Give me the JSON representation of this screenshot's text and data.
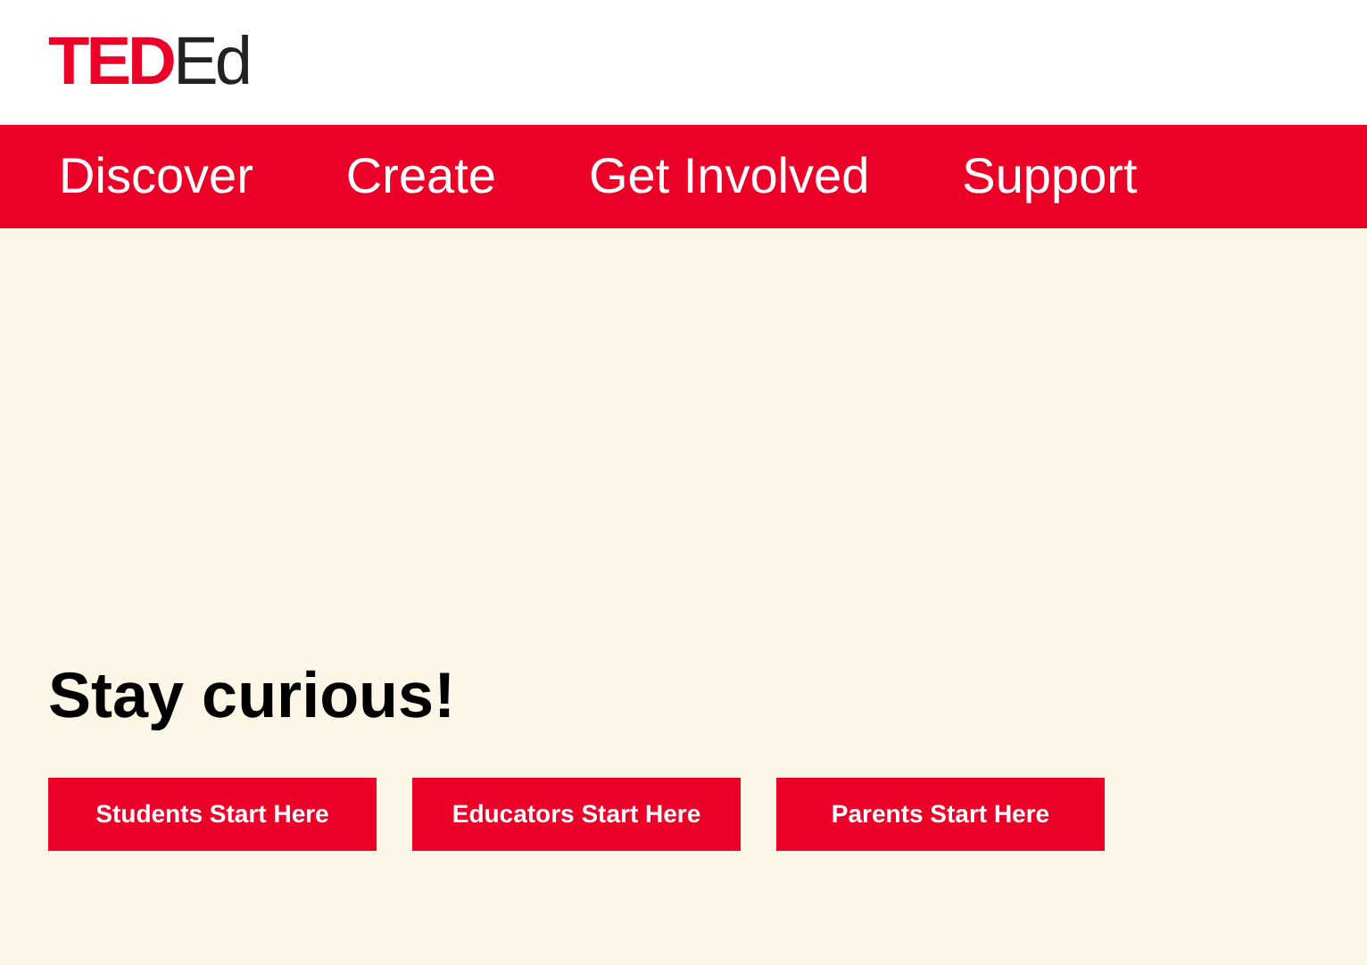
{
  "logo": {
    "primary": "TED",
    "secondary": "Ed"
  },
  "nav": [
    "Discover",
    "Create",
    "Get Involved",
    "Support"
  ],
  "hero": {
    "heading": "Stay curious!",
    "buttons": [
      "Students Start Here",
      "Educators Start Here",
      "Parents Start Here"
    ]
  }
}
